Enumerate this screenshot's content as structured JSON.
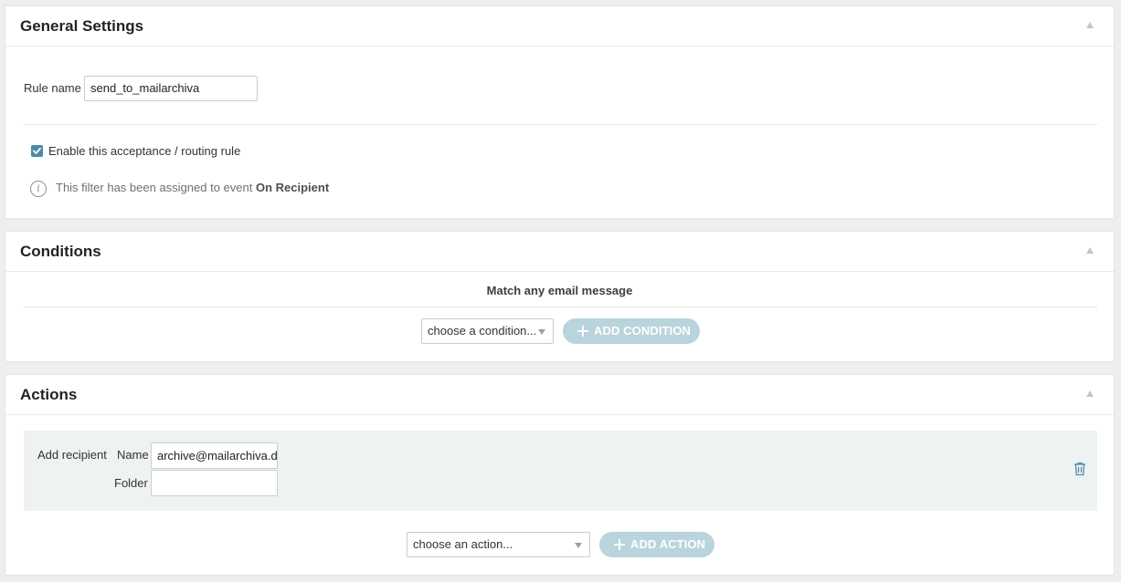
{
  "general": {
    "title": "General Settings",
    "rule_name_label": "Rule name",
    "rule_name_value": "send_to_mailarchiva",
    "enable_label": "Enable this acceptance / routing rule",
    "enabled": true,
    "info_prefix": "This filter has been assigned to event ",
    "info_event": "On Recipient"
  },
  "conditions": {
    "title": "Conditions",
    "match_text": "Match any email message",
    "select_value": "choose a condition...",
    "add_label": "ADD CONDITION"
  },
  "actions": {
    "title": "Actions",
    "row": {
      "type_label": "Add recipient",
      "name_label": "Name",
      "name_value": "archive@mailarchiva.de",
      "folder_label": "Folder",
      "folder_value": ""
    },
    "select_value": "choose an action...",
    "add_label": "ADD ACTION"
  },
  "colors": {
    "accent": "#4d8aa6",
    "add_button": "#b9d4dd",
    "trash_icon": "#4d8aa6"
  }
}
